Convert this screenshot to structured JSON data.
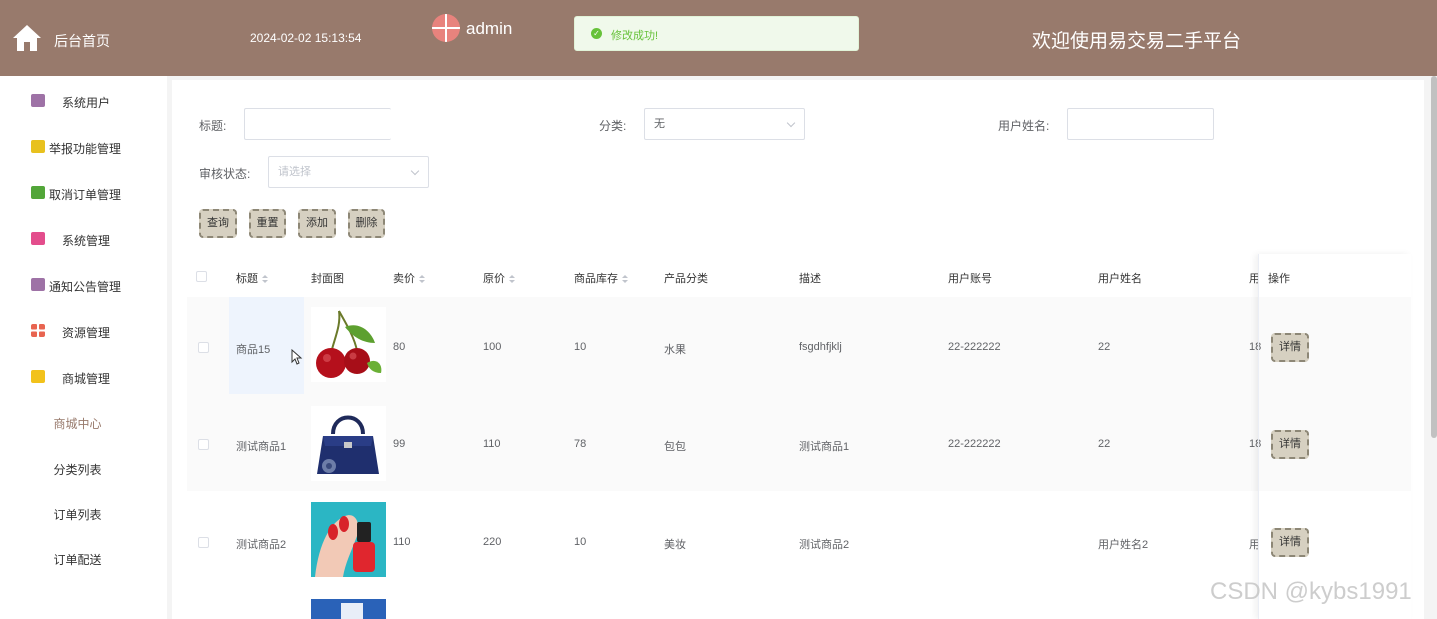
{
  "header": {
    "home_label": "后台首页",
    "datetime": "2024-02-02 15:13:54",
    "user_name": "admin",
    "toast_message": "修改成功!",
    "site_title": "欢迎使用易交易二手平台"
  },
  "sidebar": {
    "items": [
      {
        "label": "系统用户",
        "icon_color": "#9e72a6"
      },
      {
        "label": "举报功能管理",
        "icon_color": "#e8c11e"
      },
      {
        "label": "取消订单管理",
        "icon_color": "#52a639"
      },
      {
        "label": "系统管理",
        "icon_color": "#e34d8c"
      },
      {
        "label": "通知公告管理",
        "icon_color": "#9e72a6"
      },
      {
        "label": "资源管理",
        "icon_color": "#e86450"
      },
      {
        "label": "商城管理",
        "icon_color": "#f2c21b"
      }
    ],
    "sub_items": [
      {
        "label": "商城中心",
        "active": true
      },
      {
        "label": "分类列表",
        "active": false
      },
      {
        "label": "订单列表",
        "active": false
      },
      {
        "label": "订单配送",
        "active": false
      }
    ]
  },
  "filters": {
    "title_label": "标题:",
    "title_value": "",
    "category_label": "分类:",
    "category_value": "无",
    "username_label": "用户姓名:",
    "username_value": "",
    "status_label": "审核状态:",
    "status_placeholder": "请选择"
  },
  "buttons": {
    "query": "查询",
    "reset": "重置",
    "add": "添加",
    "delete": "删除"
  },
  "table": {
    "columns": [
      "标题",
      "封面图",
      "卖价",
      "原价",
      "商品库存",
      "产品分类",
      "描述",
      "用户账号",
      "用户姓名",
      "用",
      "操作"
    ],
    "rows": [
      {
        "title": "商品15",
        "sell_price": "80",
        "original_price": "100",
        "stock": "10",
        "category": "水果",
        "description": "fsgdhfjklj",
        "account": "22-222222",
        "username": "22",
        "extra": "18",
        "action": "详情",
        "image": "cherry"
      },
      {
        "title": "测试商品1",
        "sell_price": "99",
        "original_price": "110",
        "stock": "78",
        "category": "包包",
        "description": "测试商品1",
        "account": "22-222222",
        "username": "22",
        "extra": "18",
        "action": "详情",
        "image": "handbag"
      },
      {
        "title": "测试商品2",
        "sell_price": "110",
        "original_price": "220",
        "stock": "10",
        "category": "美妆",
        "description": "测试商品2",
        "account": "",
        "username": "用户姓名2",
        "extra": "用",
        "action": "详情",
        "image": "nail-polish"
      }
    ]
  },
  "watermark": "CSDN @kybs1991"
}
